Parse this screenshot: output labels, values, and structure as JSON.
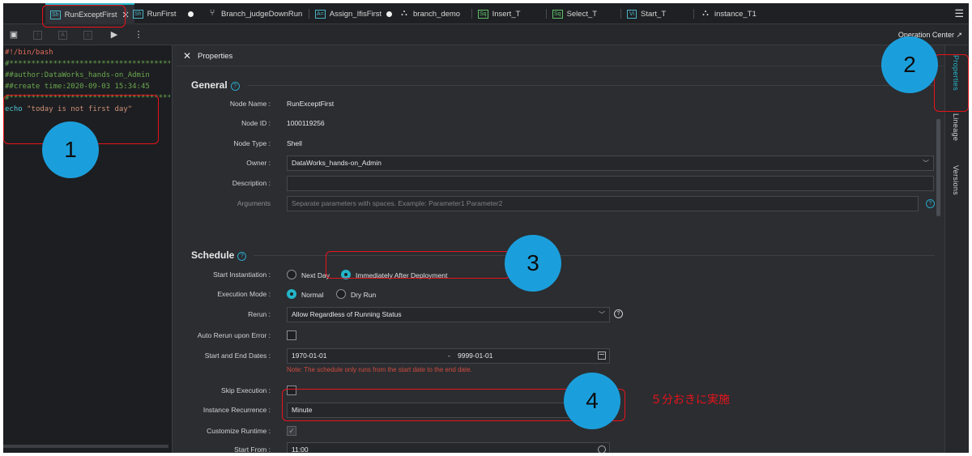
{
  "tabs": [
    {
      "label": "RunExceptFirst",
      "icon": "Sh",
      "active": true,
      "has_close": true
    },
    {
      "label": "RunFirst",
      "icon": "Sh"
    },
    {
      "label": "Branch_judgeDownRun",
      "icon": "branch-icon"
    },
    {
      "label": "Assign_IfisFirst",
      "icon": "A="
    },
    {
      "label": "branch_demo",
      "icon": "workflow-icon"
    },
    {
      "label": "Insert_T",
      "icon": "Sq"
    },
    {
      "label": "Select_T",
      "icon": "Sq"
    },
    {
      "label": "Start_T",
      "icon": "Vi"
    },
    {
      "label": "instance_T1",
      "icon": "workflow-icon"
    }
  ],
  "toolbar": {
    "operation_center": "Operation Center ↗"
  },
  "editor": {
    "lines": [
      "#!/bin/bash",
      "#********************************************",
      "##author:DataWorks_hands-on_Admin",
      "##create time:2020-09-03 15:34:45",
      "#********************************************"
    ],
    "echo_cmd": "echo",
    "echo_str": "\"today is not first day\""
  },
  "panel": {
    "title": "Properties",
    "general": {
      "heading": "General",
      "node_name_label": "Node Name :",
      "node_name": "RunExceptFirst",
      "node_id_label": "Node ID :",
      "node_id": "1000119256",
      "node_type_label": "Node Type :",
      "node_type": "Shell",
      "owner_label": "Owner :",
      "owner": "DataWorks_hands-on_Admin",
      "description_label": "Description :",
      "description": "",
      "arguments_label": "Arguments",
      "arguments_placeholder": "Separate parameters with spaces. Example: Parameter1 Parameter2"
    },
    "schedule": {
      "heading": "Schedule",
      "start_inst_label": "Start Instantiation :",
      "opt_next_day": "Next Day",
      "opt_immediately": "Immediately After Deployment",
      "exec_mode_label": "Execution Mode :",
      "opt_normal": "Normal",
      "opt_dry_run": "Dry Run",
      "rerun_label": "Rerun :",
      "rerun_value": "Allow Regardless of Running Status",
      "auto_rerun_label": "Auto Rerun upon Error :",
      "start_end_label": "Start and End Dates :",
      "start_date": "1970-01-01",
      "date_sep": "-",
      "end_date": "9999-01-01",
      "date_note": "Note: The schedule only runs from the start date to the end date.",
      "skip_exec_label": "Skip Execution :",
      "recurrence_label": "Instance Recurrence :",
      "recurrence_value": "Minute",
      "custom_runtime_label": "Customize Runtime :",
      "start_from_label": "Start From :",
      "start_from_value": "11:00"
    }
  },
  "rail": {
    "properties": "Properties",
    "lineage": "Lineage",
    "versions": "Versions"
  },
  "annotations": {
    "badge1": "1",
    "badge2": "2",
    "badge3": "3",
    "badge4": "4",
    "note": "５分おきに実施",
    "color": "#e8131b",
    "badge_color": "#1b9fdc"
  },
  "colors": {
    "accent": "#23b5c9",
    "background": "#2b2d31",
    "editor_bg": "#1d1e21"
  }
}
